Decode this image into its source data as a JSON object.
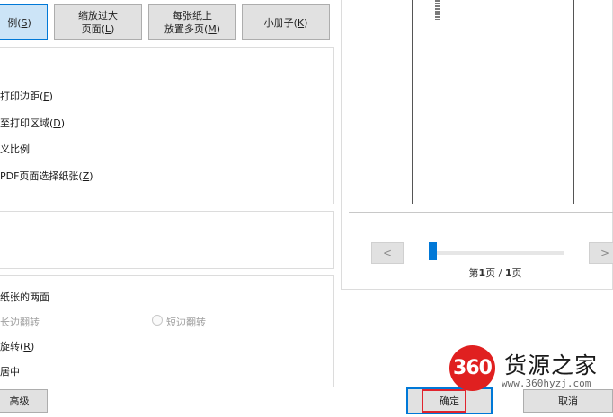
{
  "sizing_buttons": [
    {
      "label": "例(",
      "key": "S",
      "suffix": ")"
    },
    {
      "line1": "缩放过大",
      "line2": "页面(",
      "key": "L",
      "suffix": ")"
    },
    {
      "line1": "每张纸上",
      "line2": "放置多页(",
      "key": "M",
      "suffix": ")"
    },
    {
      "label": "小册子(",
      "key": "K",
      "suffix": ")"
    }
  ],
  "scale_options": [
    {
      "prefix": "打印边距(",
      "key": "F",
      "suffix": ")"
    },
    {
      "prefix": "至打印区域(",
      "key": "D",
      "suffix": ")"
    },
    {
      "prefix": "义比例",
      "key": "",
      "suffix": ""
    },
    {
      "prefix": "PDF页面选择纸张(",
      "key": "Z",
      "suffix": ")"
    }
  ],
  "duplex": {
    "title": "纸张的两面",
    "long_edge": "长边翻转",
    "short_edge": "短边翻转",
    "rotate_prefix": "旋转(",
    "rotate_key": "R",
    "rotate_suffix": ")",
    "center": "居中"
  },
  "advanced_button": "高级",
  "preview": {
    "prev": "<",
    "next": ">",
    "page_prefix": "第",
    "page_current": "1",
    "page_mid": "页 / ",
    "page_total": "1",
    "page_suffix": "页",
    "slider_position": 0.0
  },
  "ok_button": "确定",
  "cancel_button": "取消",
  "watermark": {
    "logo_text": "360",
    "title": "货源之家",
    "url": "www.360hyzj.com"
  },
  "colors": {
    "accent": "#0078d7",
    "highlight": "#e0242e",
    "watermark_red": "#e02020"
  }
}
